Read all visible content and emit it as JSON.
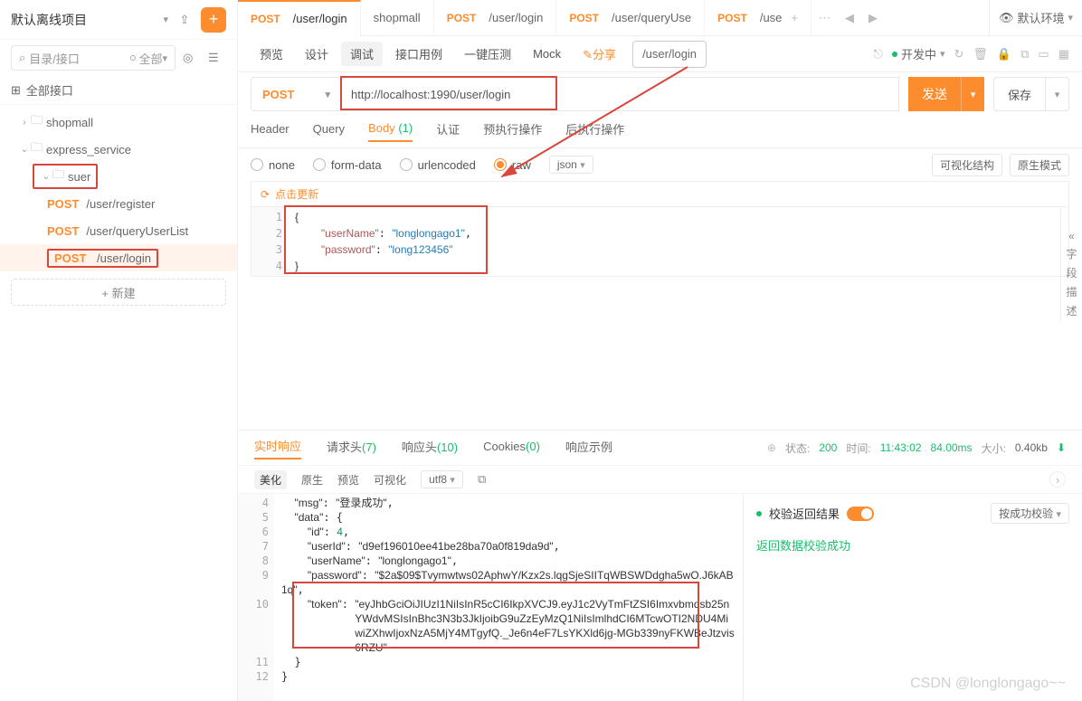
{
  "project": {
    "title": "默认离线项目"
  },
  "search": {
    "placeholder": "目录/接口",
    "scope": "全部"
  },
  "all_interfaces": "全部接口",
  "new_button": "+ 新建",
  "tree": {
    "folder1": "shopmall",
    "folder2": "express_service",
    "folder3": "suer",
    "api1": {
      "method": "POST",
      "path": "/user/register"
    },
    "api2": {
      "method": "POST",
      "path": "/user/queryUserList"
    },
    "api3": {
      "method": "POST",
      "path": "/user/login"
    }
  },
  "tabs": {
    "t1": {
      "method": "POST",
      "label": "/user/login"
    },
    "t2": {
      "label": "shopmall"
    },
    "t3": {
      "method": "POST",
      "label": "/user/login"
    },
    "t4": {
      "method": "POST",
      "label": "/user/queryUse"
    },
    "t5": {
      "method": "POST",
      "label": "/use"
    }
  },
  "env": {
    "label": "默认环境"
  },
  "toolbar": {
    "preview": "预览",
    "design": "设计",
    "debug": "调试",
    "cases": "接口用例",
    "pressure": "一键压测",
    "mock": "Mock",
    "share": "分享",
    "url_short": "/user/login",
    "dev_status": "开发中"
  },
  "request": {
    "method": "POST",
    "url": "http://localhost:1990/user/login",
    "send": "发送",
    "save": "保存"
  },
  "req_tabs": {
    "header": "Header",
    "query": "Query",
    "body": "Body",
    "body_count": "(1)",
    "auth": "认证",
    "pre": "预执行操作",
    "post": "后执行操作"
  },
  "body_type": {
    "none": "none",
    "formdata": "form-data",
    "urlencoded": "urlencoded",
    "raw": "raw",
    "json": "json",
    "view_struct": "可视化结构",
    "native": "原生模式"
  },
  "editor": {
    "update_hint": "点击更新",
    "line1": "{",
    "k1": "\"userName\"",
    "v1": "\"longlongago1\"",
    "k2": "\"password\"",
    "v2": "\"long123456\"",
    "line4": "}"
  },
  "sidebar_strip": {
    "c1": "«",
    "c2": "字",
    "c3": "段",
    "c4": "描",
    "c5": "述"
  },
  "response_tabs": {
    "realtime": "实时响应",
    "req_head": "请求头",
    "req_head_n": "(7)",
    "resp_head": "响应头",
    "resp_head_n": "(10)",
    "cookies": "Cookies",
    "cookies_n": "(0)",
    "example": "响应示例"
  },
  "status": {
    "label_state": "状态:",
    "code": "200",
    "label_time": "时间:",
    "clock": "11:43:02",
    "ms": "84.00ms",
    "label_size": "大小:",
    "size": "0.40kb"
  },
  "resp_toolbar": {
    "beautify": "美化",
    "origin": "原生",
    "preview": "预览",
    "visual": "可视化",
    "enc": "utf8"
  },
  "validation": {
    "title": "校验返回结果",
    "ok": "返回数据校验成功",
    "by_success": "按成功校验"
  },
  "resp_body": {
    "l4": {
      "k": "\"msg\"",
      "v": "\"登录成功\""
    },
    "l5": {
      "k": "\"data\""
    },
    "l6": {
      "k": "\"id\"",
      "v": "4"
    },
    "l7": {
      "k": "\"userId\"",
      "v": "\"d9ef196010ee41be28ba70a0f819da9d\""
    },
    "l8": {
      "k": "\"userName\"",
      "v": "\"longlongago1\""
    },
    "l9": {
      "k": "\"password\"",
      "v": "\"$2a$09$Tvymwtws02AphwY/Kzx2s.lqgSjeSIITqWBSWDdgha5wO.J6kAB1q\""
    },
    "l10": {
      "k": "\"token\"",
      "v": "\"eyJhbGciOiJIUzI1NiIsInR5cCI6IkpXVCJ9.eyJ1c2VyTmFtZSI6Imxvbmdsb25nYWdvMSIsInBhc3N3b3JkIjoibG9uZzEyMzQ1NiIsImlhdCI6MTcwOTI2NDU4MiwiZXhwIjoxNzA5MjY4MTgyfQ._Je6n4eF7LsYKXld6jg-MGb339nyFKWBeJtzvis6RZU\""
    }
  },
  "watermark": "CSDN @longlongago~~"
}
